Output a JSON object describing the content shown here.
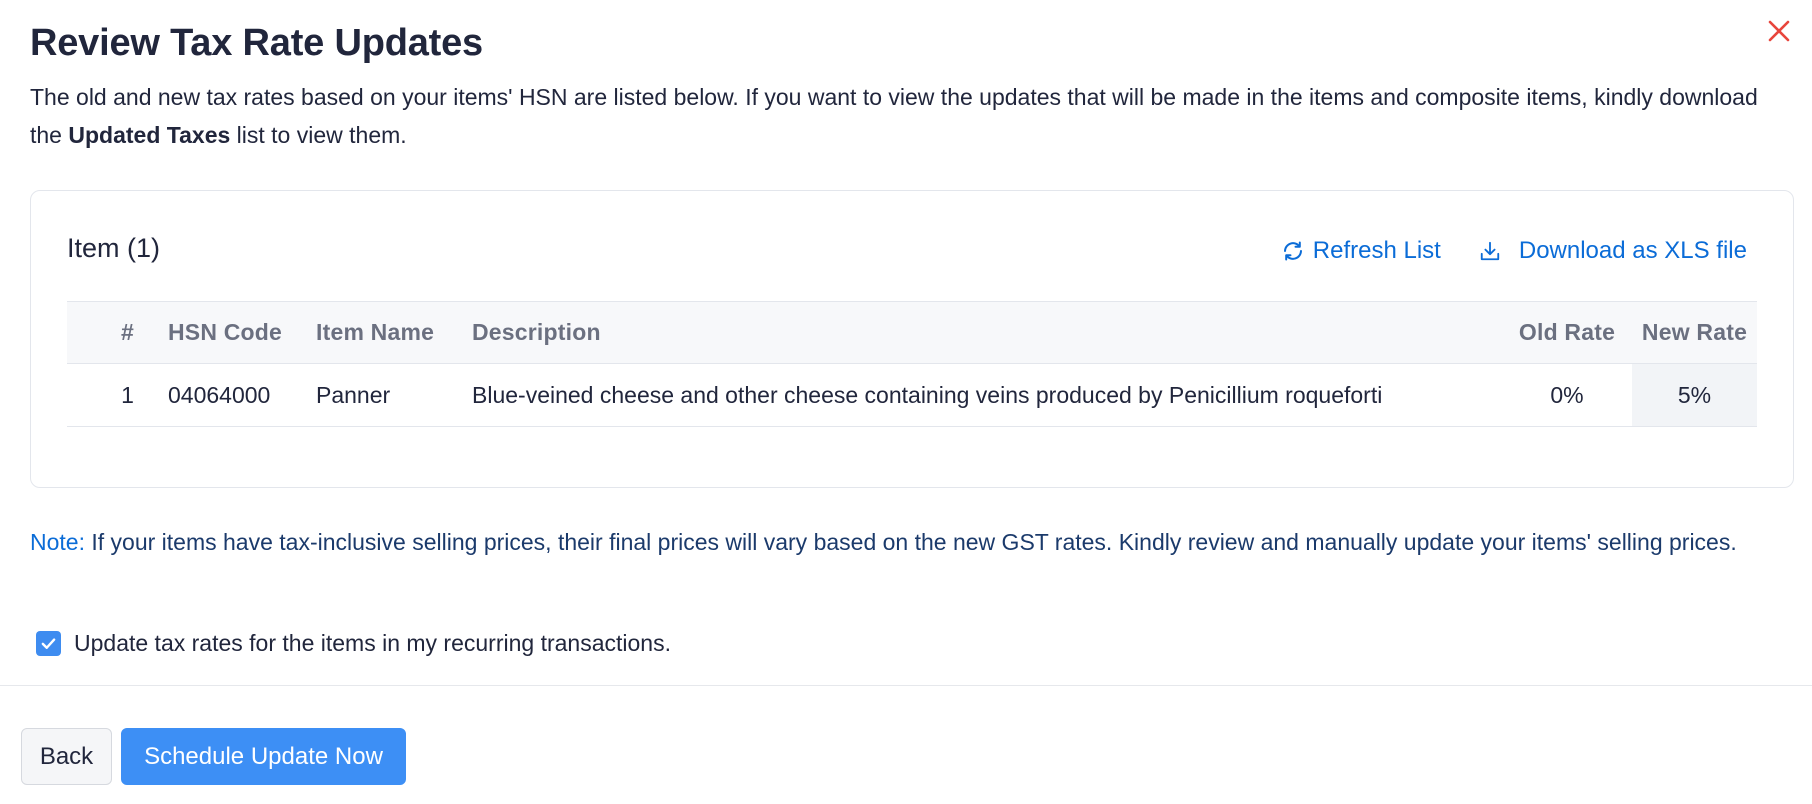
{
  "dialog": {
    "title": "Review Tax Rate Updates",
    "intro_text": "The old and new tax rates based on your items' HSN are listed below. If you want to view the updates that will be made in the items and composite items, kindly download the",
    "intro_bold": "Updated Taxes",
    "intro_tail": "list to view them."
  },
  "card": {
    "title": "Item (1)",
    "refresh_label": "Refresh List",
    "download_label": "Download as XLS file"
  },
  "table": {
    "headers": {
      "num": "#",
      "hsn": "HSN Code",
      "name": "Item Name",
      "description": "Description",
      "old_rate": "Old Rate",
      "new_rate": "New Rate"
    },
    "rows": [
      {
        "num": "1",
        "hsn": "04064000",
        "name": "Panner",
        "description": "Blue-veined cheese and other cheese containing veins produced by Penicillium roqueforti",
        "old_rate": "0%",
        "new_rate": "5%"
      }
    ]
  },
  "note": {
    "label": "Note:",
    "text": "If your items have tax-inclusive selling prices, their final prices will vary based on the new GST rates. Kindly review and manually update your items' selling prices."
  },
  "recurring_checkbox": {
    "label": "Update tax rates for the items in my recurring transactions.",
    "checked": true
  },
  "footer": {
    "back_label": "Back",
    "primary_label": "Schedule Update Now"
  },
  "colors": {
    "accent": "#3d8ff5",
    "link": "#0b6cd7",
    "close": "#e8453c",
    "new_rate": "#1a7d3e"
  },
  "icons": {
    "close": "close-icon",
    "refresh": "refresh-icon",
    "download": "download-icon",
    "check": "check-icon"
  }
}
